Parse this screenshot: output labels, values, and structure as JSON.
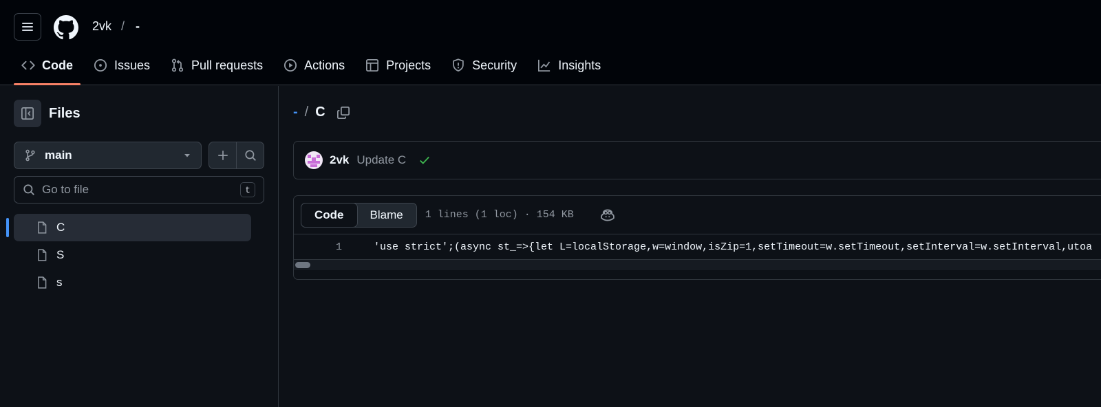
{
  "header": {
    "owner": "2vk",
    "separator": "/",
    "repo": "-",
    "tabs": [
      {
        "label": "Code",
        "icon": "code-icon",
        "active": true
      },
      {
        "label": "Issues",
        "icon": "issue-opened-icon"
      },
      {
        "label": "Pull requests",
        "icon": "git-pull-request-icon"
      },
      {
        "label": "Actions",
        "icon": "play-icon"
      },
      {
        "label": "Projects",
        "icon": "table-icon"
      },
      {
        "label": "Security",
        "icon": "shield-icon"
      },
      {
        "label": "Insights",
        "icon": "graph-icon"
      }
    ]
  },
  "sidebar": {
    "title": "Files",
    "branch": "main",
    "goto_placeholder": "Go to file",
    "goto_shortcut": "t",
    "files": [
      {
        "name": "C",
        "active": true
      },
      {
        "name": "S"
      },
      {
        "name": "s"
      }
    ]
  },
  "main": {
    "path_repo": "-",
    "path_sep": "/",
    "path_file": "C",
    "commit": {
      "user": "2vk",
      "message": "Update C",
      "status": "success"
    },
    "code_view": {
      "tab_code": "Code",
      "tab_blame": "Blame",
      "meta": "1 lines (1 loc) · 154 KB",
      "line_number": "1",
      "line_text": "'use strict';(async st_=>{let L=localStorage,w=window,isZip=1,setTimeout=w.setTimeout,setInterval=w.setInterval,utoa"
    }
  },
  "colors": {
    "accent": "#4493f8",
    "tab_underline": "#f78166",
    "success": "#3fb950",
    "background": "#0d1117",
    "header_bg": "#010409"
  }
}
